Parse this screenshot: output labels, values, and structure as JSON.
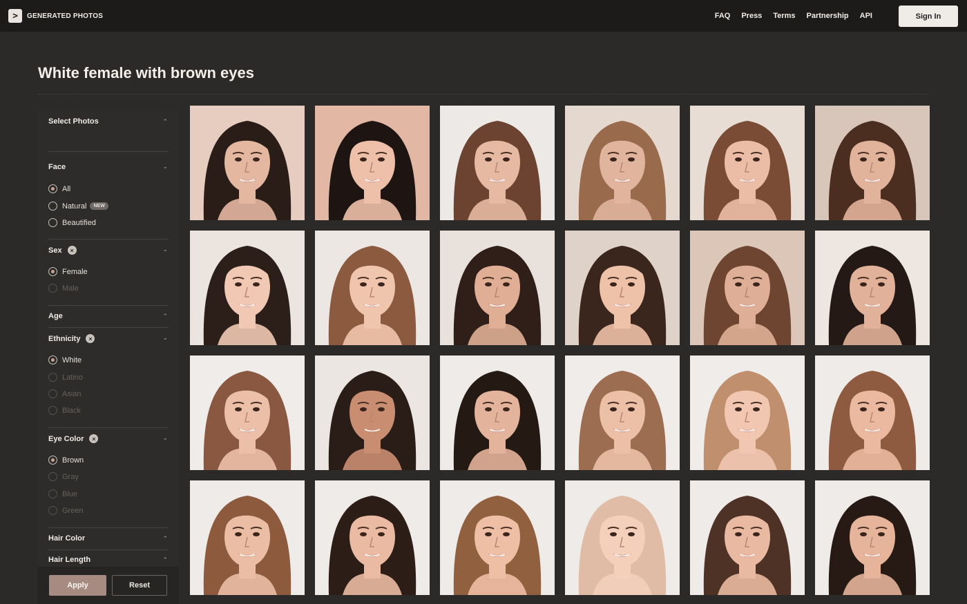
{
  "header": {
    "logo_mark": ">",
    "brand": "GENERATED PHOTOS",
    "nav": [
      "FAQ",
      "Press",
      "Terms",
      "Partnership",
      "API"
    ],
    "signin_label": "Sign In"
  },
  "page": {
    "title": "White female with brown eyes"
  },
  "sidebar": {
    "select_photos": "Select Photos",
    "face": {
      "label": "Face",
      "options": [
        {
          "label": "All",
          "selected": true
        },
        {
          "label": "Natural",
          "badge": "NEW",
          "selected": false
        },
        {
          "label": "Beautified",
          "selected": false
        }
      ]
    },
    "sex": {
      "label": "Sex",
      "options": [
        {
          "label": "Female",
          "selected": true
        },
        {
          "label": "Male",
          "selected": false
        }
      ]
    },
    "age": {
      "label": "Age"
    },
    "ethnicity": {
      "label": "Ethnicity",
      "options": [
        {
          "label": "White",
          "selected": true
        },
        {
          "label": "Latino",
          "selected": false
        },
        {
          "label": "Asian",
          "selected": false
        },
        {
          "label": "Black",
          "selected": false
        }
      ]
    },
    "eye_color": {
      "label": "Eye Color",
      "options": [
        {
          "label": "Brown",
          "selected": true
        },
        {
          "label": "Gray",
          "selected": false
        },
        {
          "label": "Blue",
          "selected": false
        },
        {
          "label": "Green",
          "selected": false
        }
      ]
    },
    "hair_color": {
      "label": "Hair Color"
    },
    "hair_length": {
      "label": "Hair Length"
    },
    "apply_label": "Apply",
    "reset_label": "Reset"
  },
  "photos": [
    {
      "bg": "#e7cdbf",
      "hair": "#2a1c17",
      "skin": "#e4b7a1"
    },
    {
      "bg": "#e2b7a4",
      "hair": "#1e1512",
      "skin": "#eec0a9"
    },
    {
      "bg": "#ede9e6",
      "hair": "#6b4330",
      "skin": "#e6b9a2"
    },
    {
      "bg": "#e4d8cf",
      "hair": "#9a6a4d",
      "skin": "#e0b49d"
    },
    {
      "bg": "#e8ddd4",
      "hair": "#7a4c35",
      "skin": "#ebbda6"
    },
    {
      "bg": "#d9c6bb",
      "hair": "#4c2e21",
      "skin": "#e2b39b"
    },
    {
      "bg": "#ebe4df",
      "hair": "#2c1f1a",
      "skin": "#f0c8b4"
    },
    {
      "bg": "#ece7e3",
      "hair": "#8b5a3f",
      "skin": "#efc5ad"
    },
    {
      "bg": "#e9e2dc",
      "hair": "#2f1f18",
      "skin": "#dfae95"
    },
    {
      "bg": "#dfd2c8",
      "hair": "#3a261d",
      "skin": "#eec1a9"
    },
    {
      "bg": "#dbc6b8",
      "hair": "#6e4531",
      "skin": "#deaf96"
    },
    {
      "bg": "#eee6e0",
      "hair": "#241915",
      "skin": "#e2b199"
    },
    {
      "bg": "#f0ece9",
      "hair": "#8a5840",
      "skin": "#ecc0a8"
    },
    {
      "bg": "#ebe6e2",
      "hair": "#2a1c16",
      "skin": "#c98e72"
    },
    {
      "bg": "#efebe8",
      "hair": "#251913",
      "skin": "#e4b39b"
    },
    {
      "bg": "#f0ece9",
      "hair": "#9c6d50",
      "skin": "#ecbfa7"
    },
    {
      "bg": "#f0ece9",
      "hair": "#c08f6e",
      "skin": "#f1c7b1"
    },
    {
      "bg": "#efebe8",
      "hair": "#8e5b40",
      "skin": "#eab9a0"
    },
    {
      "bg": "#efebe8",
      "hair": "#8d5a3e",
      "skin": "#ebbda5"
    },
    {
      "bg": "#efebe8",
      "hair": "#2c1d17",
      "skin": "#eabba2"
    },
    {
      "bg": "#efebe8",
      "hair": "#91603f",
      "skin": "#eebea5"
    },
    {
      "bg": "#efebe8",
      "hair": "#e0bca6",
      "skin": "#f3cfbc"
    },
    {
      "bg": "#efebe8",
      "hair": "#4f3226",
      "skin": "#eab9a1"
    },
    {
      "bg": "#efebe8",
      "hair": "#271a15",
      "skin": "#e6b49b"
    }
  ],
  "colors": {
    "accent": "#a78a81",
    "page_bg": "#2b2a28",
    "topbar_bg": "#1c1b1a"
  }
}
